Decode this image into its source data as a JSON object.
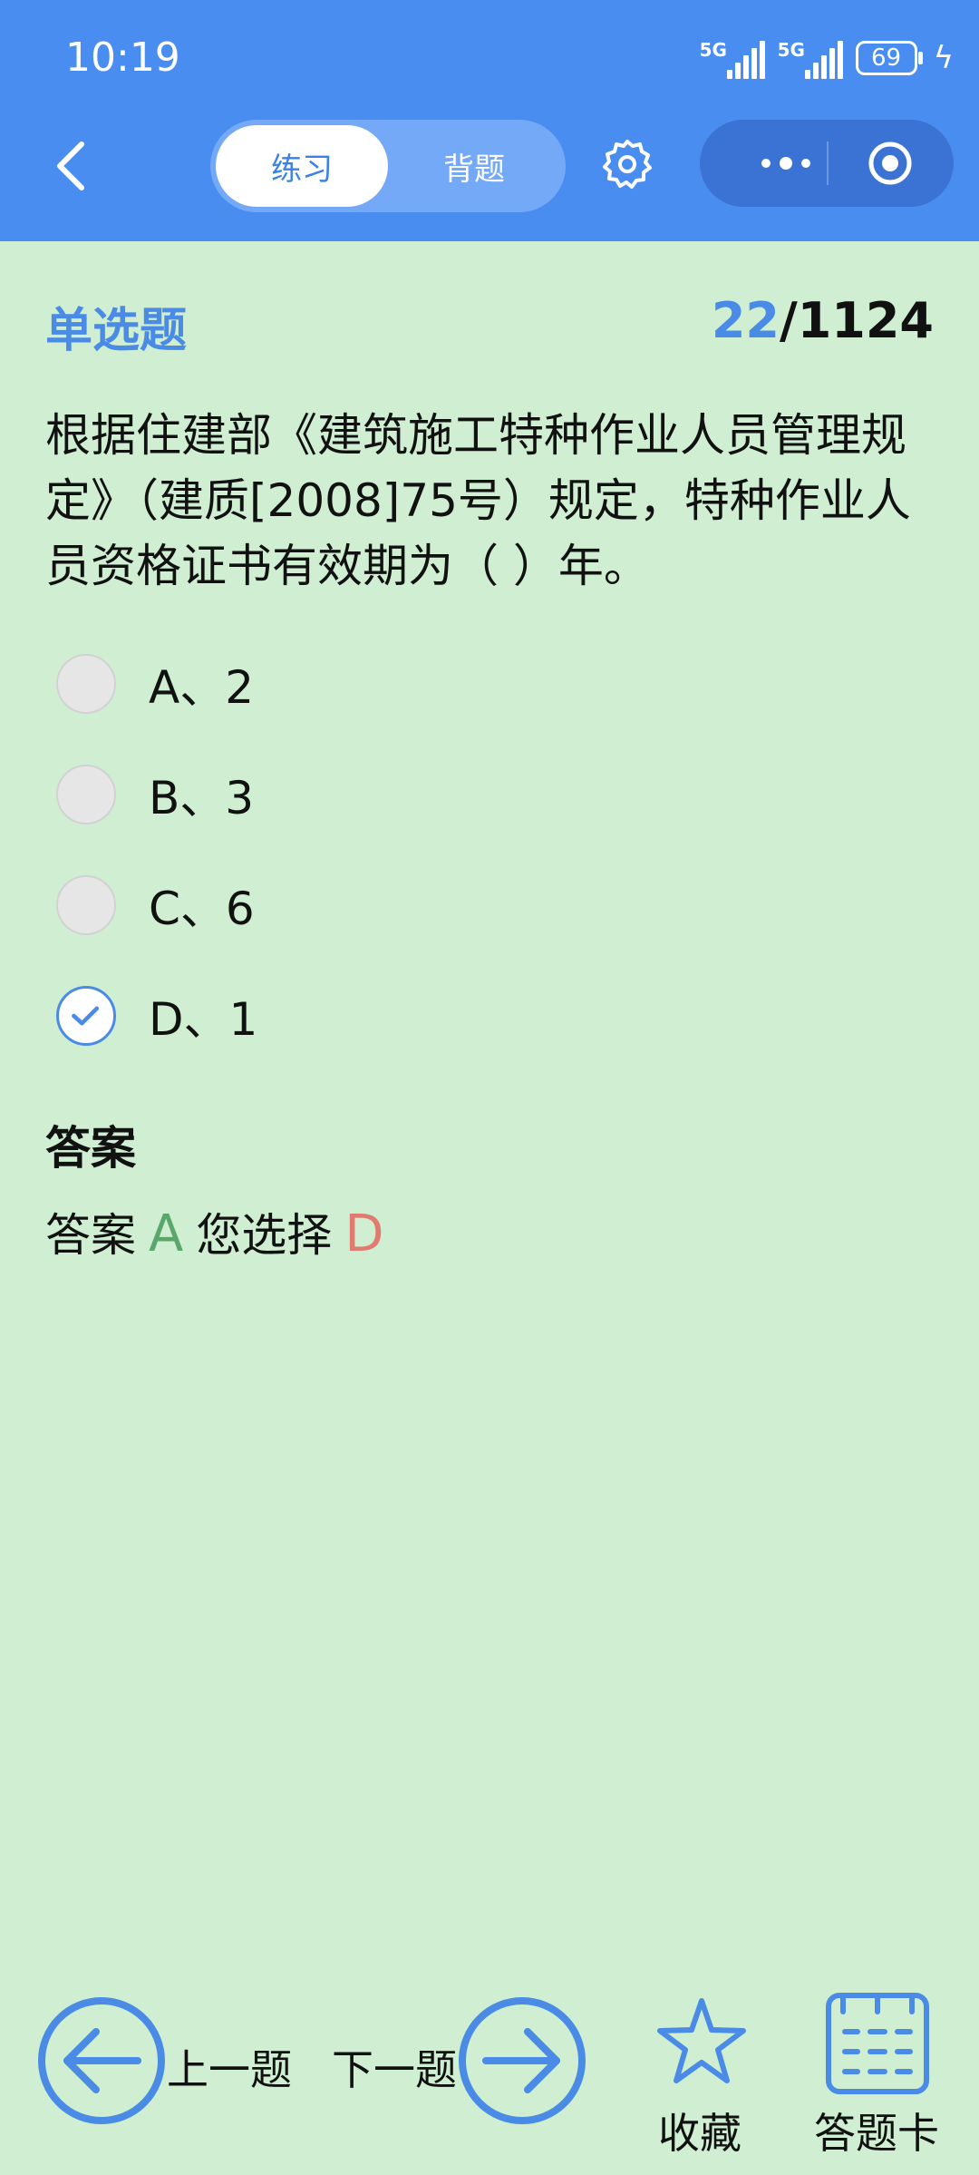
{
  "status": {
    "time": "10:19",
    "signal1": "5G",
    "signal2": "5G",
    "battery": "69"
  },
  "header": {
    "tab_practice": "练习",
    "tab_memorize": "背题"
  },
  "question": {
    "type": "单选题",
    "current": "22",
    "total": "/1124",
    "text": "根据住建部《建筑施工特种作业人员管理规定》（建质[2008]75号）规定，特种作业人员资格证书有效期为（ ）年。",
    "options": [
      {
        "label": "A、2",
        "selected": false
      },
      {
        "label": "B、3",
        "selected": false
      },
      {
        "label": "C、6",
        "selected": false
      },
      {
        "label": "D、1",
        "selected": true
      }
    ]
  },
  "answer": {
    "title": "答案",
    "prefix": "答案",
    "correct": "A",
    "chosen_prefix": "您选择",
    "chosen": "D"
  },
  "footer": {
    "prev": "上一题",
    "next": "下一题",
    "favorite": "收藏",
    "card": "答题卡"
  },
  "colors": {
    "accent": "#4a8be6",
    "header": "#4a8df0",
    "background": "#cfeed2",
    "correct": "#5ba76b",
    "wrong": "#e07b6f"
  }
}
